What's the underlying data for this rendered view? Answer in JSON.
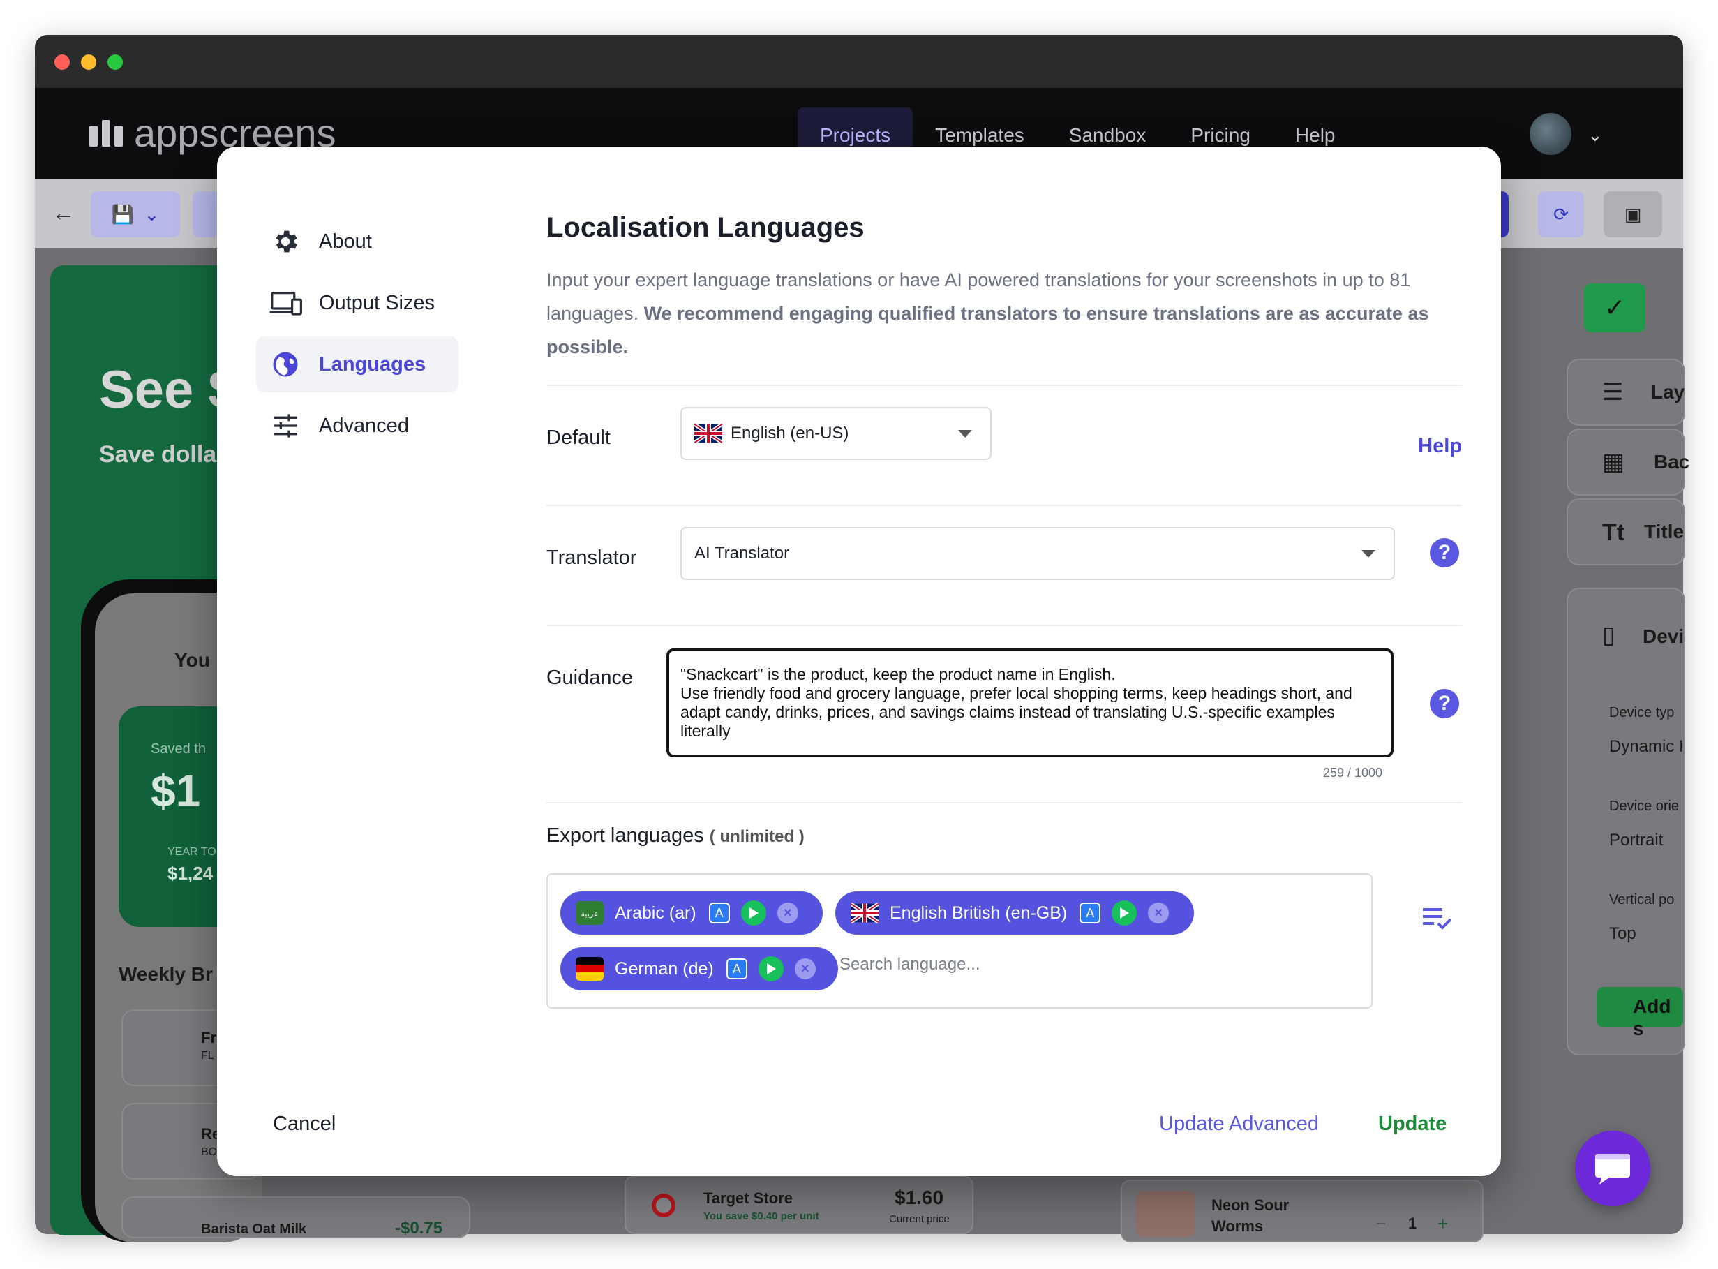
{
  "window": {
    "brand": "appscreens"
  },
  "nav": {
    "items": [
      "Projects",
      "Templates",
      "Sandbox",
      "Pricing",
      "Help"
    ],
    "active": "Projects"
  },
  "background": {
    "heading": "See $",
    "subheading": "Save dollar",
    "phone_title": "You",
    "card_label": "Saved th",
    "card_value": "$1",
    "card_sub_label": "YEAR TO",
    "card_sub_value": "$1,24",
    "weekly": "Weekly Br",
    "items": [
      {
        "name": "Fr",
        "sub": "FL"
      },
      {
        "name": "Re",
        "sub": "BO"
      },
      {
        "name": "Barista Oat Milk",
        "price": "-$0.75"
      }
    ],
    "store_name": "Target Store",
    "store_save": "You save $0.40 per unit",
    "store_price": "$1.60",
    "store_price_label": "Current price",
    "product_name": "Neon Sour Worms",
    "product_qty": "1",
    "right_panel": [
      "Lay",
      "Bac",
      "Title",
      "Devi"
    ],
    "device_type_label": "Device typ",
    "device_type_value": "Dynamic I",
    "device_orient_label": "Device orie",
    "device_orient_value": "Portrait",
    "vertical_label": "Vertical po",
    "vertical_value": "Top",
    "add_label": "Add s"
  },
  "modal": {
    "menu": [
      {
        "label": "About",
        "icon": "gear-icon"
      },
      {
        "label": "Output Sizes",
        "icon": "devices-icon"
      },
      {
        "label": "Languages",
        "icon": "globe-icon"
      },
      {
        "label": "Advanced",
        "icon": "sliders-icon"
      }
    ],
    "active_menu": "Languages",
    "title": "Localisation Languages",
    "description_plain": "Input your expert language translations or have AI powered translations for your screenshots in up to 81 languages.",
    "description_bold": "We recommend engaging qualified translators to ensure translations are as accurate as possible.",
    "default_label": "Default",
    "default_value": "English (en-US)",
    "help_link": "Help",
    "translator_label": "Translator",
    "translator_value": "AI Translator",
    "guidance_label": "Guidance",
    "guidance_text": "\"Snackcart\" is the product, keep the product name in English.\nUse friendly food and grocery language, prefer local shopping terms, keep headings short, and adapt candy, drinks, prices, and savings claims instead of translating U.S.-specific examples literally",
    "char_count": "259 / 1000",
    "export_label": "Export languages",
    "export_note": "( unlimited )",
    "languages": [
      {
        "label": "Arabic (ar)"
      },
      {
        "label": "English British (en-GB)"
      },
      {
        "label": "German (de)"
      }
    ],
    "search_placeholder": "Search language...",
    "cancel": "Cancel",
    "update_advanced": "Update Advanced",
    "update": "Update"
  },
  "colors": {
    "accent": "#5652e0",
    "update_green": "#1f8a3a",
    "chat": "#6d29d9"
  }
}
